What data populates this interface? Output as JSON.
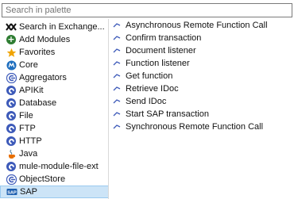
{
  "search": {
    "placeholder": "Search in palette"
  },
  "sidebar": {
    "items": [
      {
        "label": "Search in Exchange..."
      },
      {
        "label": "Add Modules"
      },
      {
        "label": "Favorites"
      },
      {
        "label": "Core"
      },
      {
        "label": "Aggregators"
      },
      {
        "label": "APIKit"
      },
      {
        "label": "Database"
      },
      {
        "label": "File"
      },
      {
        "label": "FTP"
      },
      {
        "label": "HTTP"
      },
      {
        "label": "Java"
      },
      {
        "label": "mule-module-file-ext"
      },
      {
        "label": "ObjectStore"
      },
      {
        "label": "SAP"
      }
    ]
  },
  "operations": {
    "items": [
      {
        "label": "Asynchronous Remote Function Call"
      },
      {
        "label": "Confirm transaction"
      },
      {
        "label": "Document listener"
      },
      {
        "label": "Function listener"
      },
      {
        "label": "Get function"
      },
      {
        "label": "Retrieve IDoc"
      },
      {
        "label": "Send IDoc"
      },
      {
        "label": "Start SAP transaction"
      },
      {
        "label": "Synchronous Remote Function Call"
      }
    ]
  },
  "colors": {
    "accent": "#3d5ab9",
    "selection": "#cce4f7",
    "favorite": "#f0a400",
    "add": "#2e7d32"
  }
}
